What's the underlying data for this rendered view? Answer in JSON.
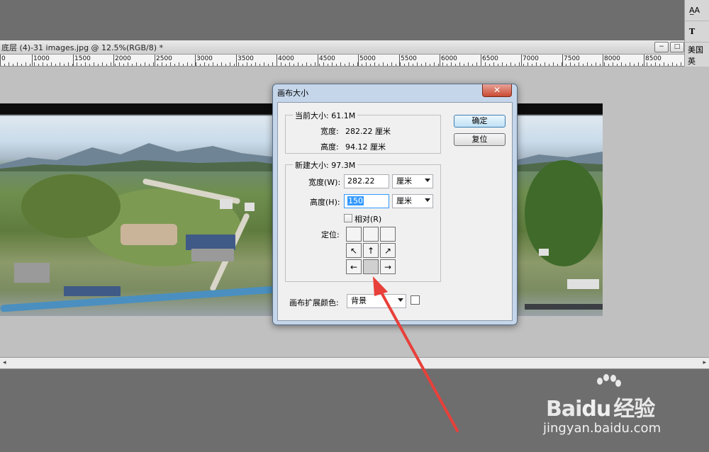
{
  "document": {
    "title": "底层 (4)-31 images.jpg @ 12.5%(RGB/8) *",
    "minimize": "−",
    "restore": "□"
  },
  "right_panel": {
    "row1": "A̲A",
    "row2": "T",
    "row3": "美国英"
  },
  "ruler": {
    "labels": [
      "0",
      "1000",
      "1500",
      "2000",
      "2500",
      "3000",
      "3500",
      "4000",
      "4500",
      "5000",
      "5500",
      "6000",
      "6500",
      "7000",
      "7500",
      "8000",
      "8500"
    ]
  },
  "dialog": {
    "title": "画布大小",
    "close": "✕",
    "ok_label": "确定",
    "reset_label": "复位",
    "current": {
      "legend": "当前大小: 61.1M",
      "width_label": "宽度:",
      "width_value": "282.22 厘米",
      "height_label": "高度:",
      "height_value": "94.12 厘米"
    },
    "new": {
      "legend": "新建大小: 97.3M",
      "width_label": "宽度(W):",
      "width_value": "282.22",
      "width_unit": "厘米",
      "height_label": "高度(H):",
      "height_value": "150",
      "height_unit": "厘米",
      "relative_label": "相对(R)",
      "anchor_label": "定位:",
      "anchor_arrows": [
        "",
        "",
        "",
        "↖",
        "↑",
        "↗",
        "←",
        "",
        "→"
      ]
    },
    "extension": {
      "label": "画布扩展颜色:",
      "value": "背景"
    }
  },
  "watermark": {
    "logo_text_1": "Bai",
    "logo_text_2": "du",
    "logo_text_3": "经验",
    "url": "jingyan.baidu.com"
  },
  "colors": {
    "annotation_arrow": "#e8403a",
    "dialog_frame": "#c5d6ea",
    "primary_button": "#bfe2f6"
  }
}
